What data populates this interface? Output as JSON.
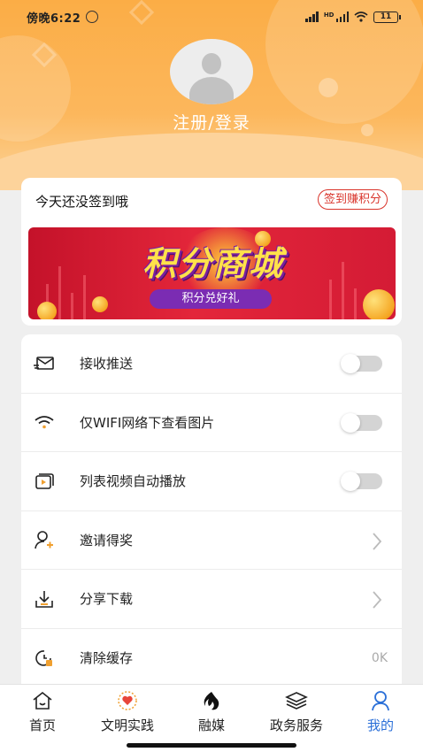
{
  "status_bar": {
    "time": "傍晚6:22",
    "signal_label": "HD",
    "battery": "11"
  },
  "profile": {
    "login_label": "注册/登录"
  },
  "checkin": {
    "prompt": "今天还没签到哦",
    "button_label": "签到赚积分"
  },
  "banner": {
    "title": "积分商城",
    "subtitle": "积分兑好礼"
  },
  "settings": {
    "items": [
      {
        "label": "接收推送",
        "icon": "envelope-icon",
        "control": "toggle",
        "on": false
      },
      {
        "label": "仅WIFI网络下查看图片",
        "icon": "wifi-icon",
        "control": "toggle",
        "on": false
      },
      {
        "label": "列表视频自动播放",
        "icon": "video-play-icon",
        "control": "toggle",
        "on": false
      },
      {
        "label": "邀请得奖",
        "icon": "invite-user-icon",
        "control": "chevron"
      },
      {
        "label": "分享下载",
        "icon": "download-icon",
        "control": "chevron"
      },
      {
        "label": "清除缓存",
        "icon": "clear-cache-icon",
        "control": "value",
        "value": "0K"
      }
    ]
  },
  "tabbar": {
    "tabs": [
      {
        "label": "首页",
        "icon": "home-icon",
        "active": false
      },
      {
        "label": "文明实践",
        "icon": "heart-badge-icon",
        "active": false
      },
      {
        "label": "融媒",
        "icon": "flame-icon",
        "active": false
      },
      {
        "label": "政务服务",
        "icon": "layers-icon",
        "active": false
      },
      {
        "label": "我的",
        "icon": "user-icon",
        "active": true
      }
    ]
  },
  "colors": {
    "header_orange": "#fbad46",
    "accent_red": "#d9342b",
    "active_tab_blue": "#2a6fd8",
    "banner_purple": "#7b2cb3"
  }
}
